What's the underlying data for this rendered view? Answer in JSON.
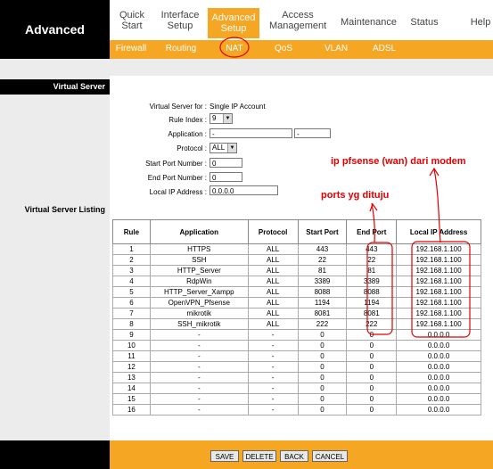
{
  "brand": "Advanced",
  "main_nav": [
    {
      "line1": "Quick",
      "line2": "Start"
    },
    {
      "line1": "Interface",
      "line2": "Setup"
    },
    {
      "line1": "Advanced",
      "line2": "Setup"
    },
    {
      "line1": "Access",
      "line2": "Management"
    },
    {
      "line1": "Maintenance",
      "line2": ""
    },
    {
      "line1": "Status",
      "line2": ""
    },
    {
      "line1": "Help",
      "line2": ""
    }
  ],
  "sub_nav": [
    "Firewall",
    "Routing",
    "NAT",
    "QoS",
    "VLAN",
    "ADSL"
  ],
  "section_title": "Virtual Server",
  "listing_title": "Virtual Server Listing",
  "form": {
    "vs_for_label": "Virtual Server for :",
    "vs_for_value": "Single IP Account",
    "rule_index_label": "Rule Index :",
    "rule_index_value": "9",
    "application_label": "Application :",
    "application_value": "-",
    "application_value2": "-",
    "protocol_label": "Protocol :",
    "protocol_value": "ALL",
    "start_port_label": "Start Port Number :",
    "start_port_value": "0",
    "end_port_label": "End Port Number :",
    "end_port_value": "0",
    "local_ip_label": "Local IP Address :",
    "local_ip_value": "0.0.0.0"
  },
  "table": {
    "headers": [
      "Rule",
      "Application",
      "Protocol",
      "Start Port",
      "End Port",
      "Local IP Address"
    ],
    "rows": [
      [
        "1",
        "HTTPS",
        "ALL",
        "443",
        "443",
        "192.168.1.100"
      ],
      [
        "2",
        "SSH",
        "ALL",
        "22",
        "22",
        "192.168.1.100"
      ],
      [
        "3",
        "HTTP_Server",
        "ALL",
        "81",
        "81",
        "192.168.1.100"
      ],
      [
        "4",
        "RdpWin",
        "ALL",
        "3389",
        "3389",
        "192.168.1.100"
      ],
      [
        "5",
        "HTTP_Server_Xampp",
        "ALL",
        "8088",
        "8088",
        "192.168.1.100"
      ],
      [
        "6",
        "OpenVPN_Pfsense",
        "ALL",
        "1194",
        "1194",
        "192.168.1.100"
      ],
      [
        "7",
        "mikrotik",
        "ALL",
        "8081",
        "8081",
        "192.168.1.100"
      ],
      [
        "8",
        "SSH_mikrotik",
        "ALL",
        "222",
        "222",
        "192.168.1.100"
      ],
      [
        "9",
        "-",
        "-",
        "0",
        "0",
        "0.0.0.0"
      ],
      [
        "10",
        "-",
        "-",
        "0",
        "0",
        "0.0.0.0"
      ],
      [
        "11",
        "-",
        "-",
        "0",
        "0",
        "0.0.0.0"
      ],
      [
        "12",
        "-",
        "-",
        "0",
        "0",
        "0.0.0.0"
      ],
      [
        "13",
        "-",
        "-",
        "0",
        "0",
        "0.0.0.0"
      ],
      [
        "14",
        "-",
        "-",
        "0",
        "0",
        "0.0.0.0"
      ],
      [
        "15",
        "-",
        "-",
        "0",
        "0",
        "0.0.0.0"
      ],
      [
        "16",
        "-",
        "-",
        "0",
        "0",
        "0.0.0.0"
      ]
    ]
  },
  "buttons": [
    "SAVE",
    "DELETE",
    "BACK",
    "CANCEL"
  ],
  "annotations": {
    "wan_note": "ip pfsense (wan) dari modem",
    "ports_note": "ports yg dituju"
  },
  "colors": {
    "accent": "#f5a623",
    "annotation": "#e00000",
    "brand_bg": "#000000"
  }
}
